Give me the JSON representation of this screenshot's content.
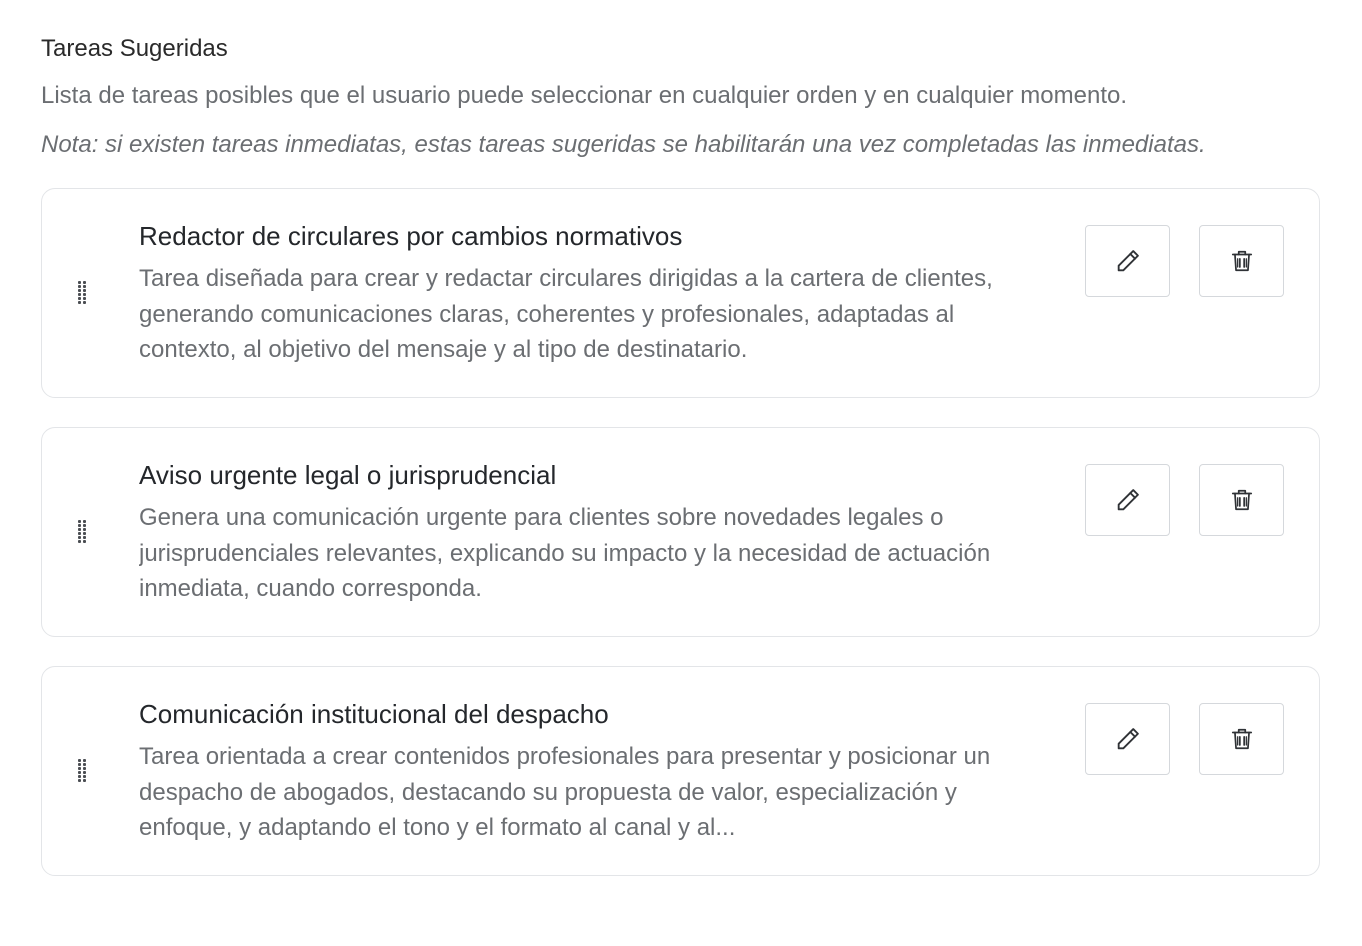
{
  "section": {
    "title": "Tareas Sugeridas",
    "description": "Lista de tareas posibles que el usuario puede seleccionar en cualquier orden y en cualquier momento.",
    "note": "Nota: si existen tareas inmediatas, estas tareas sugeridas se habilitarán una vez completadas las inmediatas."
  },
  "icons": {
    "drag": "drag-handle-icon",
    "edit": "pencil-icon",
    "delete": "trash-icon"
  },
  "tasks": [
    {
      "title": "Redactor de circulares por cambios normativos",
      "description": "Tarea diseñada para crear y redactar circulares dirigidas a la cartera de clientes, generando comunicaciones claras, coherentes y profesionales, adaptadas al contexto, al objetivo del mensaje y al tipo de destinatario."
    },
    {
      "title": "Aviso urgente legal o jurisprudencial",
      "description": "Genera una comunicación urgente para clientes sobre novedades legales o jurisprudenciales relevantes, explicando su impacto y la necesidad de actuación inmediata, cuando corresponda."
    },
    {
      "title": "Comunicación institucional del despacho",
      "description": "Tarea orientada a crear contenidos profesionales para presentar y posicionar un despacho de abogados, destacando su propuesta de valor, especialización y enfoque, y adaptando el tono y el formato al canal y al..."
    }
  ]
}
